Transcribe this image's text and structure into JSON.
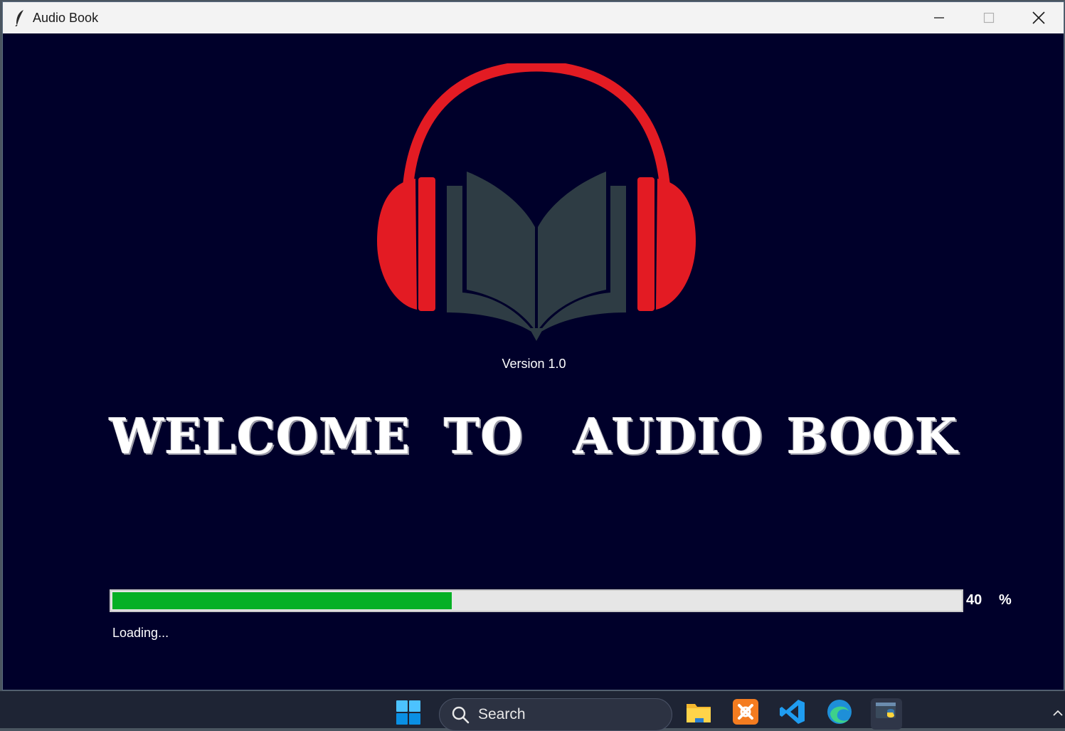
{
  "window": {
    "title": "Audio Book",
    "app_icon": "feather-icon",
    "controls": [
      "minimize-icon",
      "maximize-icon",
      "close-icon"
    ]
  },
  "logo": {
    "icon": "headphones-book-logo",
    "headphone_color": "#e31b23",
    "book_color": "#2e3c44"
  },
  "version_label": "Version 1.0",
  "welcome": {
    "words": [
      "WELCOME",
      "TO",
      "AUDIO",
      "BOOK"
    ]
  },
  "progress": {
    "percent": 40,
    "value_label": "40",
    "unit_label": "%",
    "status_text": "Loading...",
    "fill_color": "#06b025",
    "track_color": "#e6e6e6"
  },
  "taskbar": {
    "search_placeholder": "Search",
    "apps": [
      "windows-start-icon",
      "file-explorer-icon",
      "xampp-icon",
      "vscode-icon",
      "edge-icon",
      "python-app-icon"
    ],
    "tray": "chevron-up-icon"
  },
  "colors": {
    "background": "#00002a",
    "text": "#ffffff"
  }
}
